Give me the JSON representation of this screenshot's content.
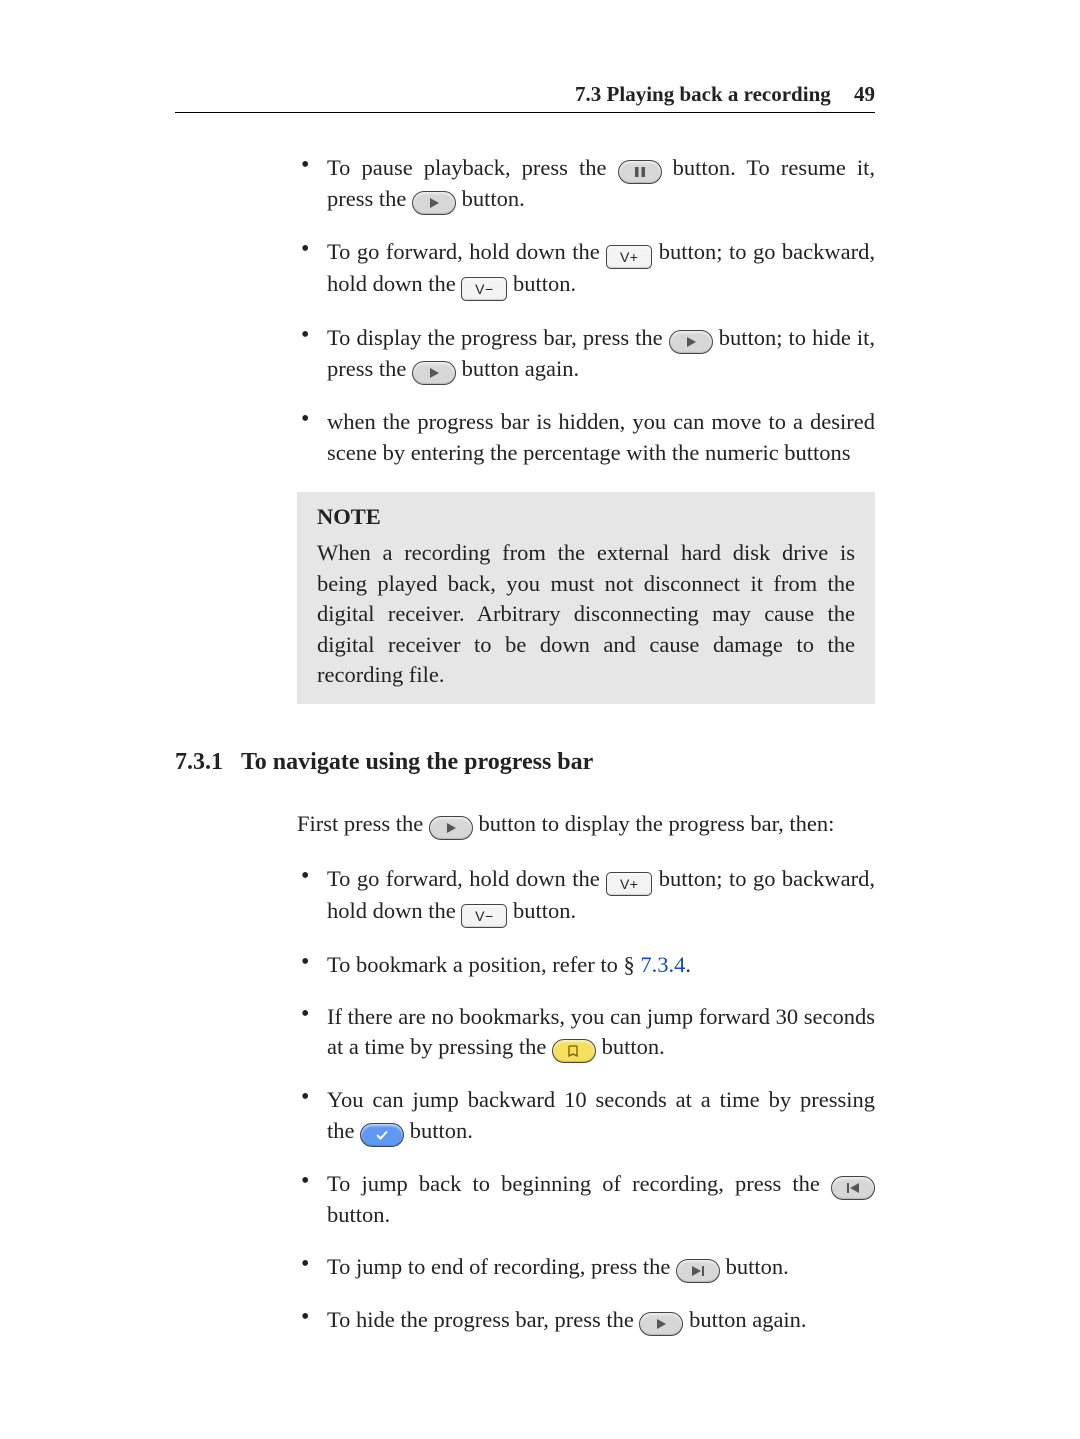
{
  "header": {
    "section_title": "7.3 Playing back a recording",
    "page_number": "49"
  },
  "bulletsA": {
    "i0": {
      "a": "To pause playback, press the ",
      "b": " button. To resume it, press the ",
      "c": " button."
    },
    "i1": {
      "a": "To go forward, hold down the ",
      "b": " button; to go backward, hold down the ",
      "c": " button."
    },
    "i2": {
      "a": "To display the progress bar, press the ",
      "b": " button; to hide it, press the ",
      "c": " button again."
    },
    "i3": {
      "a": "when the progress bar is hidden, you can move to a desired scene by entering the percentage with the numeric buttons"
    }
  },
  "note": {
    "label": "NOTE",
    "text": "When a recording from the external hard disk drive is being played back, you must not disconnect it from the digital receiver. Arbitrary disconnecting may cause the digital receiver to be down and cause damage to the recording file."
  },
  "subsection": {
    "num": "7.3.1",
    "title": "To navigate using the progress bar"
  },
  "intro": {
    "a": "First press the ",
    "b": " button to display the progress bar, then:"
  },
  "bulletsB": {
    "i0": {
      "a": "To go forward, hold down the ",
      "b": " button; to go backward, hold down the ",
      "c": " button."
    },
    "i1": {
      "a": "To bookmark a position, refer to § ",
      "ref": "7.3.4",
      "b": "."
    },
    "i2": {
      "a": "If there are no bookmarks, you can jump forward 30 seconds at a time by pressing the ",
      "b": " button."
    },
    "i3": {
      "a": "You can jump backward 10 seconds at a time by pressing the ",
      "b": " button."
    },
    "i4": {
      "a": "To jump back to beginning of recording, press the ",
      "b": " button."
    },
    "i5": {
      "a": "To jump to end of recording, press the ",
      "b": " button."
    },
    "i6": {
      "a": "To hide the progress bar, press the ",
      "b": " button again."
    }
  },
  "keys": {
    "vplus": "V+",
    "vminus": "V−"
  }
}
